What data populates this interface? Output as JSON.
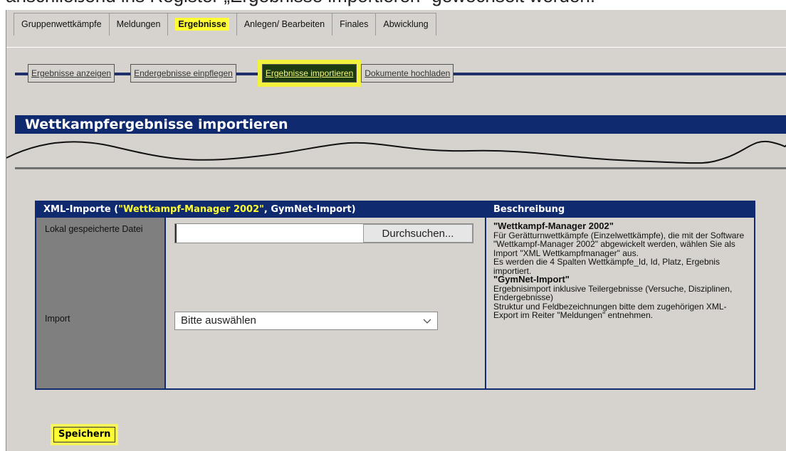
{
  "caption": "anschließend ins Register „Ergebnisse importieren“ gewechselt werden.",
  "tabs": [
    {
      "label": "Gruppenwettkämpfe"
    },
    {
      "label": "Meldungen"
    },
    {
      "label": "Ergebnisse",
      "active": true
    },
    {
      "label": "Anlegen/ Bearbeiten"
    },
    {
      "label": "Finales"
    },
    {
      "label": "Abwicklung"
    }
  ],
  "subnav": [
    {
      "label": "Ergebnisse anzeigen"
    },
    {
      "label": "Endergebnisse einpflegen"
    },
    {
      "label": "Ergebnisse importieren",
      "active": true
    },
    {
      "label": "Dokumente hochladen"
    }
  ],
  "panel": {
    "title": "Wettkampfergebnisse importieren"
  },
  "import_box": {
    "header_prefix": "XML-Importe (",
    "header_highlight": "\"Wettkampf-Manager 2002\"",
    "header_suffix": ", GymNet-Import)",
    "header_desc": "Beschreibung",
    "file_label": "Lokal gespeicherte Datei",
    "file_value": "",
    "browse_label": "Durchsuchen...",
    "import_label": "Import",
    "import_selected": "Bitte auswählen",
    "desc_title_1": "\"Wettkampf-Manager 2002\"",
    "desc_text_1": "Für Gerätturnwettkämpfe (Einzelwettkämpfe), die mit der Software \"Wettkampf-Manager 2002\" abgewickelt werden, wählen Sie als Import \"XML Wettkampfmanager\" aus.",
    "desc_text_2": "Es werden die 4 Spalten Wettkämpfe_Id, Id, Platz, Ergebnis importiert.",
    "desc_title_2": "\"GymNet-Import\"",
    "desc_text_3": "Ergebnisimport inklusive Teilergebnisse (Versuche, Disziplinen, Endergebnisse)",
    "desc_text_4": "Struktur und Feldbezeichnungen bitte dem zugehörigen XML-Export im Reiter \"Meldungen\" entnehmen."
  },
  "save_label": "Speichern",
  "colors": {
    "navy": "#0f2a6e",
    "highlight": "#ffff33",
    "bg": "#d6d3ce"
  }
}
